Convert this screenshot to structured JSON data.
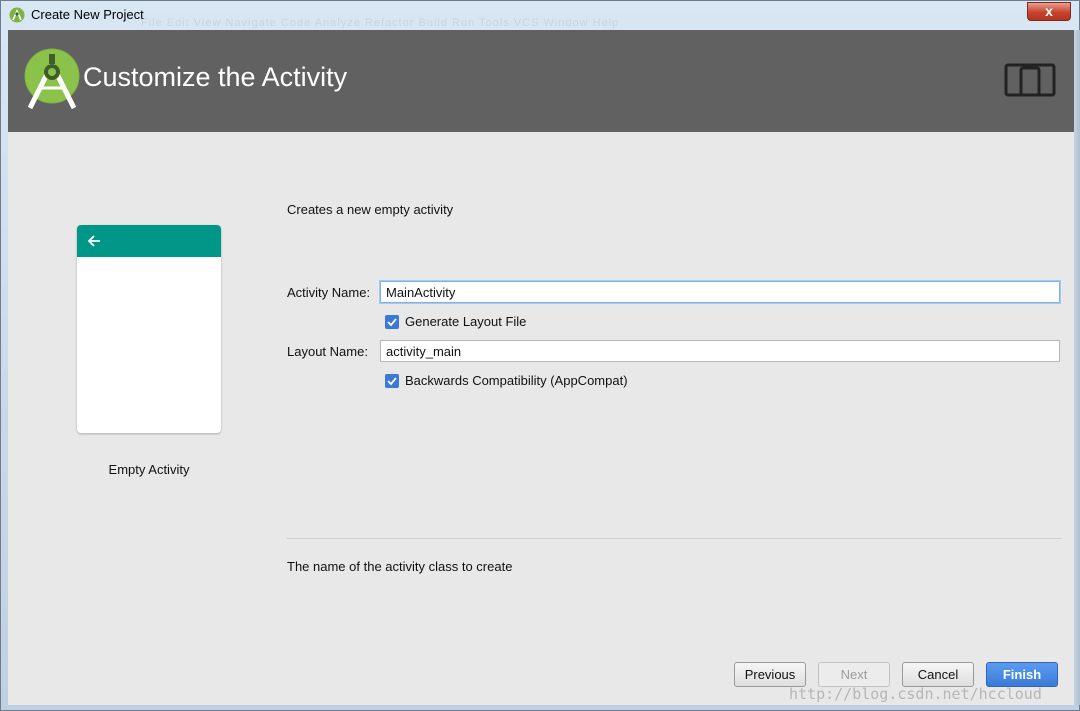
{
  "window": {
    "title": "Create New Project",
    "ghost_menu": "File  Edit  View  Navigate  Code  Analyze  Refactor  Build  Run  Tools  VCS  Window  Help",
    "close_label": "x"
  },
  "header": {
    "title": "Customize the Activity"
  },
  "template": {
    "label": "Empty Activity"
  },
  "form": {
    "description": "Creates a new empty activity",
    "activity_name_label": "Activity Name:",
    "activity_name_value": "MainActivity",
    "generate_layout_label": "Generate Layout File",
    "generate_layout_checked": true,
    "layout_name_label": "Layout Name:",
    "layout_name_value": "activity_main",
    "backwards_compat_label": "Backwards Compatibility (AppCompat)",
    "backwards_compat_checked": true
  },
  "hint": "The name of the activity class to create",
  "buttons": {
    "previous": "Previous",
    "next": "Next",
    "cancel": "Cancel",
    "finish": "Finish"
  },
  "watermark": "http://blog.csdn.net/hccloud",
  "colors": {
    "header_bg": "#616161",
    "accent_teal": "#009688",
    "primary_blue": "#3a7bd8",
    "android_green": "#8bc34a"
  }
}
